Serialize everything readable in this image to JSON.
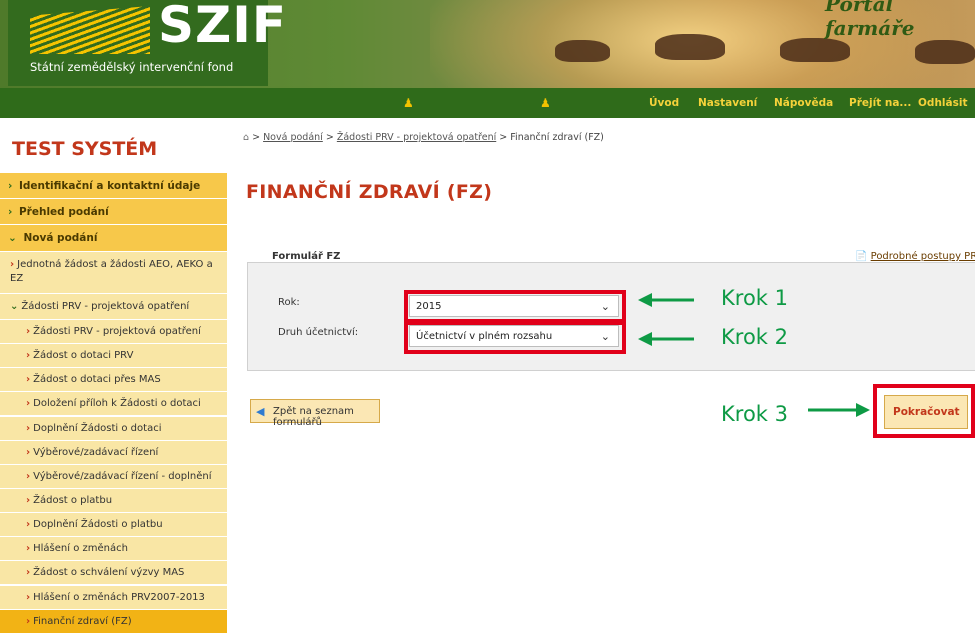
{
  "header": {
    "logo": "SZIF",
    "subtitle": "Státní zemědělský intervenční fond",
    "portal_title": "Portál farmáře"
  },
  "nav": {
    "items": [
      "Úvod",
      "Nastavení",
      "Nápověda",
      "Přejít na...",
      "Odhlásit"
    ],
    "user_icon_1": "user-icon",
    "user_icon_2": "user-icon"
  },
  "sidebar": {
    "title": "TEST SYSTÉM",
    "top_items": [
      "Identifikační a kontaktní údaje",
      "Přehled podání",
      "Nová podání"
    ],
    "sub_items": [
      "Jednotná žádost a žádosti AEO, AEKO a EZ",
      "Žádosti PRV - projektová opatření"
    ],
    "sub_sub_items": [
      "Žádosti PRV - projektová opatření",
      "Žádost o dotaci PRV",
      "Žádost o dotaci přes MAS",
      "Doložení příloh k Žádosti o dotaci",
      "Doplnění Žádosti o dotaci",
      "Výběrové/zadávací řízení",
      "Výběrové/zadávací řízení - doplnění",
      "Žádost o platbu",
      "Doplnění Žádosti o platbu",
      "Hlášení o změnách",
      "Žádost o schválení výzvy MAS",
      "Hlášení o změnách PRV2007-2013",
      "Finanční zdraví (FZ)"
    ]
  },
  "breadcrumb": {
    "sep": ">",
    "link1": "Nová podání",
    "link2": "Žádosti PRV - projektová opatření",
    "current": "Finanční zdraví (FZ)"
  },
  "page_title": "FINANČNÍ ZDRAVÍ (FZ)",
  "postupy_link": "Podrobné postupy PRV",
  "form": {
    "legend": "Formulář FZ",
    "rok_label": "Rok:",
    "rok_value": "2015",
    "druh_label": "Druh účetnictví:",
    "druh_value": "Účetnictví v plném rozsahu"
  },
  "annotations": {
    "krok1": "Krok 1",
    "krok2": "Krok 2",
    "krok3": "Krok 3",
    "arrow_color": "#0e9a45",
    "highlight_color": "#e1001a"
  },
  "buttons": {
    "back": "Zpět na seznam formulářů",
    "continue": "Pokračovat"
  }
}
